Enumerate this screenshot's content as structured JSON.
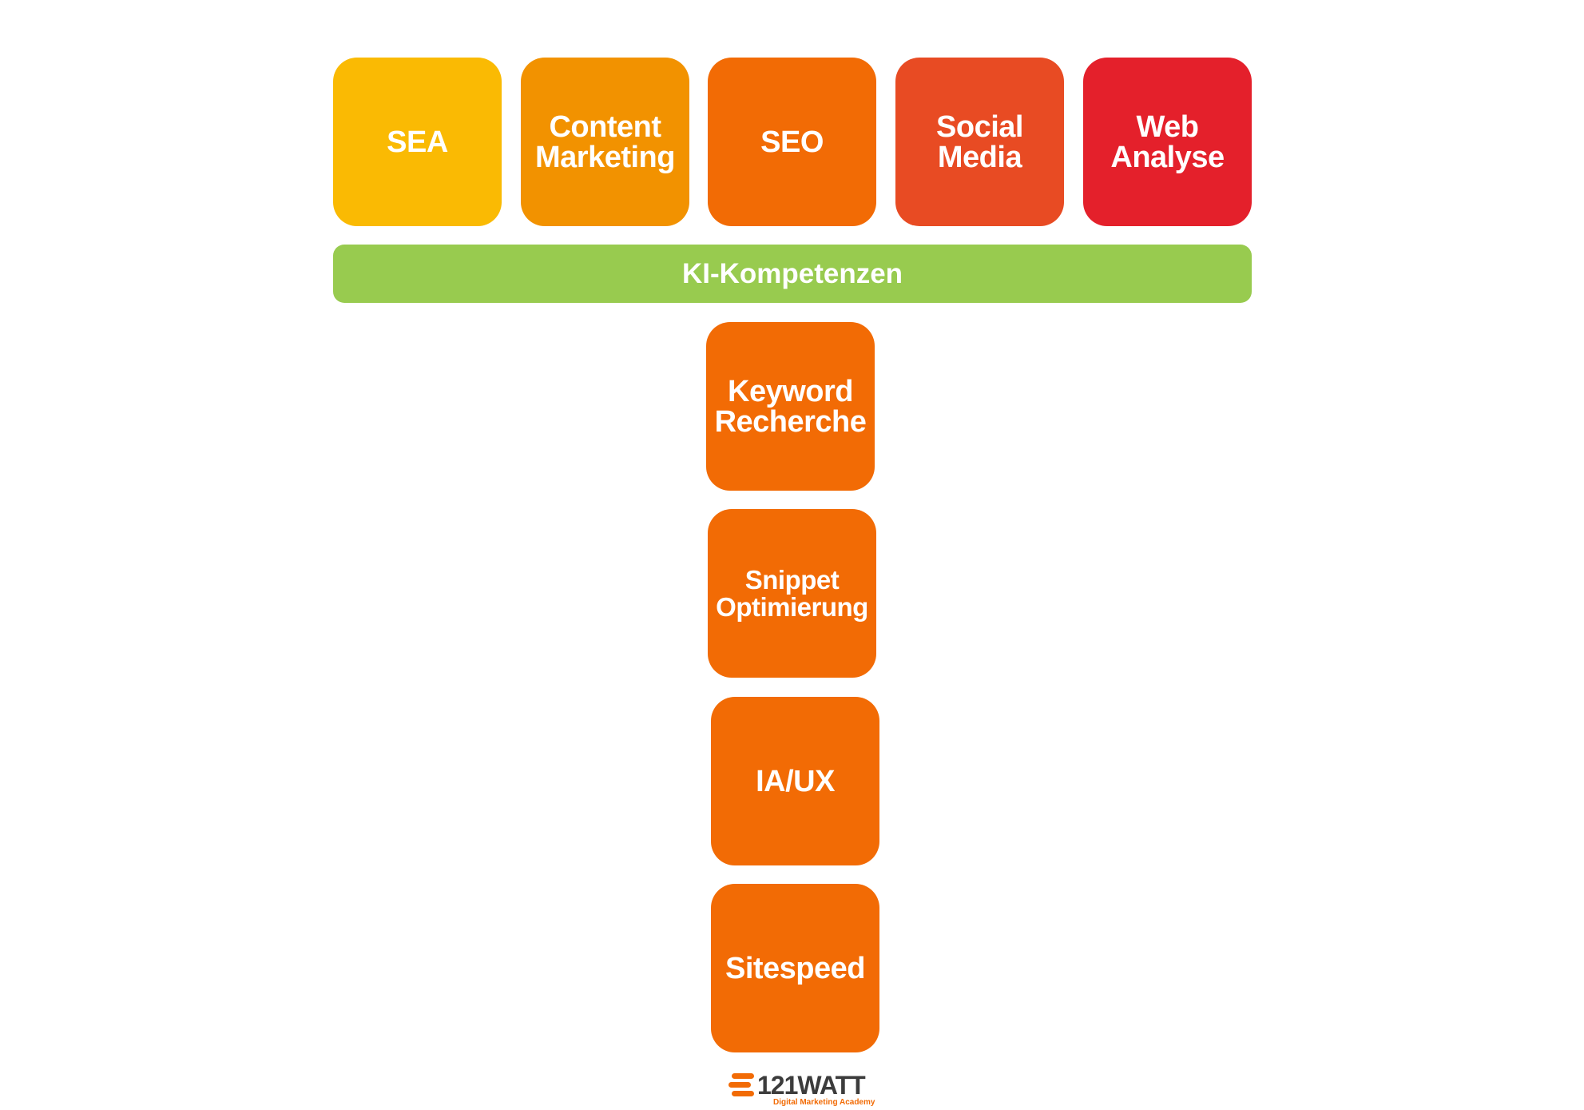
{
  "top_row": [
    {
      "label": "SEA",
      "color": "#FABA03"
    },
    {
      "label": "Content\nMarketing",
      "color": "#F29200"
    },
    {
      "label": "SEO",
      "color": "#F26B05"
    },
    {
      "label": "Social\nMedia",
      "color": "#E84B23"
    },
    {
      "label": "Web\nAnalyse",
      "color": "#E4202B"
    }
  ],
  "bar": {
    "label": "KI-Kompetenzen",
    "color": "#98CB4F"
  },
  "column": [
    {
      "label": "Keyword\nRecherche",
      "color": "#F26B05"
    },
    {
      "label": "Snippet\nOptimierung",
      "color": "#F26B05"
    },
    {
      "label": "IA/UX",
      "color": "#F26B05"
    },
    {
      "label": "Sitespeed",
      "color": "#F26B05"
    }
  ],
  "logo": {
    "name": "121WATT",
    "tagline": "Digital Marketing Academy",
    "accent": "#F26B05"
  }
}
